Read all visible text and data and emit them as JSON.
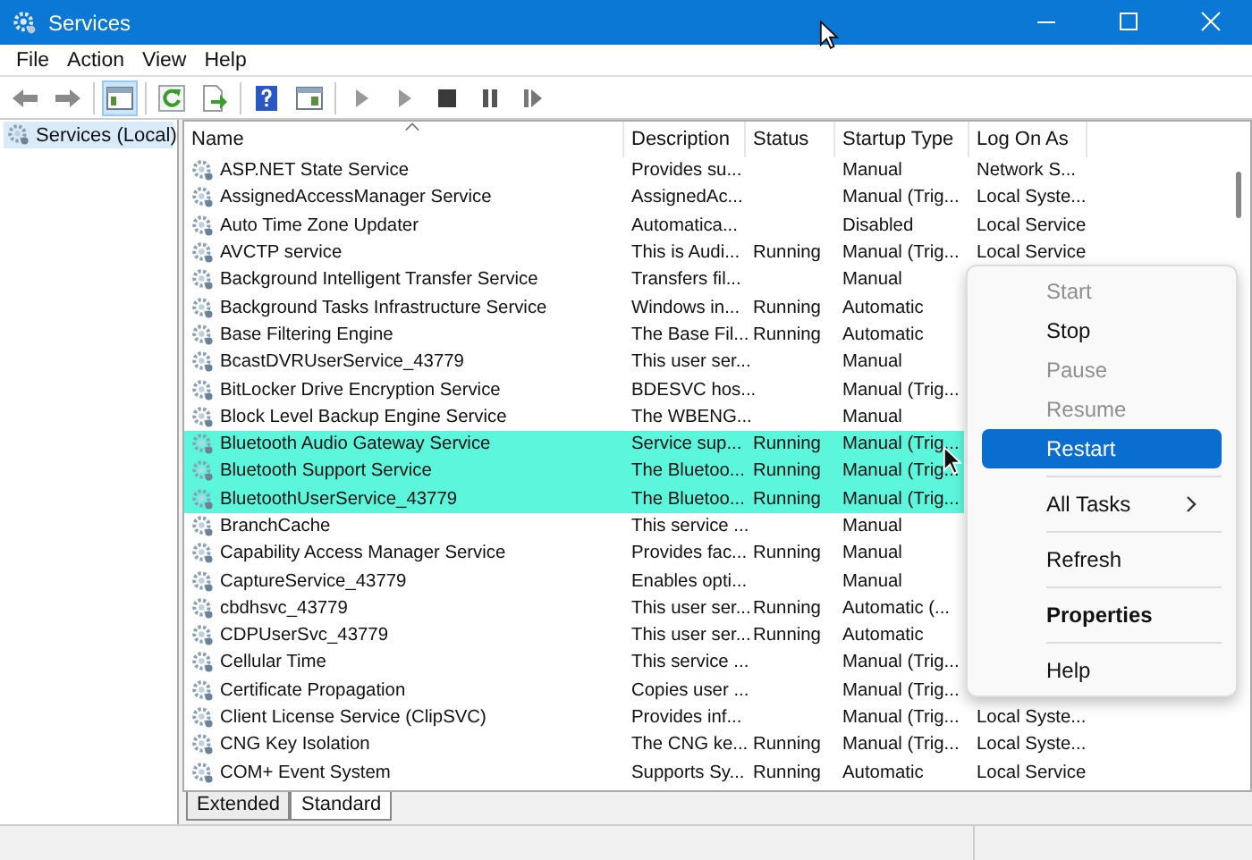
{
  "window": {
    "title": "Services"
  },
  "menu_bar": [
    "File",
    "Action",
    "View",
    "Help"
  ],
  "sidebar": {
    "items": [
      {
        "label": "Services (Local)",
        "selected": true
      }
    ]
  },
  "table": {
    "columns": [
      {
        "label": "Name",
        "sorted": true
      },
      {
        "label": "Description",
        "sorted": false
      },
      {
        "label": "Status",
        "sorted": false
      },
      {
        "label": "Startup Type",
        "sorted": false
      },
      {
        "label": "Log On As",
        "sorted": false
      }
    ],
    "rows": [
      {
        "name": "ASP.NET State Service",
        "description": "Provides su...",
        "status": "",
        "startup_type": "Manual",
        "log_on_as": "Network S...",
        "selected": false
      },
      {
        "name": "AssignedAccessManager Service",
        "description": "AssignedAc...",
        "status": "",
        "startup_type": "Manual (Trig...",
        "log_on_as": "Local Syste...",
        "selected": false
      },
      {
        "name": "Auto Time Zone Updater",
        "description": "Automatica...",
        "status": "",
        "startup_type": "Disabled",
        "log_on_as": "Local Service",
        "selected": false
      },
      {
        "name": "AVCTP service",
        "description": "This is Audi...",
        "status": "Running",
        "startup_type": "Manual (Trig...",
        "log_on_as": "Local Service",
        "selected": false
      },
      {
        "name": "Background Intelligent Transfer Service",
        "description": "Transfers fil...",
        "status": "",
        "startup_type": "Manual",
        "log_on_as": "",
        "selected": false
      },
      {
        "name": "Background Tasks Infrastructure Service",
        "description": "Windows in...",
        "status": "Running",
        "startup_type": "Automatic",
        "log_on_as": "",
        "selected": false
      },
      {
        "name": "Base Filtering Engine",
        "description": "The Base Fil...",
        "status": "Running",
        "startup_type": "Automatic",
        "log_on_as": "",
        "selected": false
      },
      {
        "name": "BcastDVRUserService_43779",
        "description": "This user ser...",
        "status": "",
        "startup_type": "Manual",
        "log_on_as": "",
        "selected": false
      },
      {
        "name": "BitLocker Drive Encryption Service",
        "description": "BDESVC hos...",
        "status": "",
        "startup_type": "Manual (Trig...",
        "log_on_as": "",
        "selected": false
      },
      {
        "name": "Block Level Backup Engine Service",
        "description": "The WBENG...",
        "status": "",
        "startup_type": "Manual",
        "log_on_as": "",
        "selected": false
      },
      {
        "name": "Bluetooth Audio Gateway Service",
        "description": "Service sup...",
        "status": "Running",
        "startup_type": "Manual (Trig...",
        "log_on_as": "",
        "selected": true
      },
      {
        "name": "Bluetooth Support Service",
        "description": "The Bluetoo...",
        "status": "Running",
        "startup_type": "Manual (Trig...",
        "log_on_as": "",
        "selected": true
      },
      {
        "name": "BluetoothUserService_43779",
        "description": "The Bluetoo...",
        "status": "Running",
        "startup_type": "Manual (Trig...",
        "log_on_as": "",
        "selected": true
      },
      {
        "name": "BranchCache",
        "description": "This service ...",
        "status": "",
        "startup_type": "Manual",
        "log_on_as": "",
        "selected": false
      },
      {
        "name": "Capability Access Manager Service",
        "description": "Provides fac...",
        "status": "Running",
        "startup_type": "Manual",
        "log_on_as": "",
        "selected": false
      },
      {
        "name": "CaptureService_43779",
        "description": "Enables opti...",
        "status": "",
        "startup_type": "Manual",
        "log_on_as": "",
        "selected": false
      },
      {
        "name": "cbdhsvc_43779",
        "description": "This user ser...",
        "status": "Running",
        "startup_type": "Automatic (...",
        "log_on_as": "",
        "selected": false
      },
      {
        "name": "CDPUserSvc_43779",
        "description": "This user ser...",
        "status": "Running",
        "startup_type": "Automatic",
        "log_on_as": "",
        "selected": false
      },
      {
        "name": "Cellular Time",
        "description": "This service ...",
        "status": "",
        "startup_type": "Manual (Trig...",
        "log_on_as": "",
        "selected": false
      },
      {
        "name": "Certificate Propagation",
        "description": "Copies user ...",
        "status": "",
        "startup_type": "Manual (Trig...",
        "log_on_as": "",
        "selected": false
      },
      {
        "name": "Client License Service (ClipSVC)",
        "description": "Provides inf...",
        "status": "",
        "startup_type": "Manual (Trig...",
        "log_on_as": "Local Syste...",
        "selected": false
      },
      {
        "name": "CNG Key Isolation",
        "description": "The CNG ke...",
        "status": "Running",
        "startup_type": "Manual (Trig...",
        "log_on_as": "Local Syste...",
        "selected": false
      },
      {
        "name": "COM+ Event System",
        "description": "Supports Sy...",
        "status": "Running",
        "startup_type": "Automatic",
        "log_on_as": "Local Service",
        "selected": false
      }
    ]
  },
  "context_menu": [
    {
      "kind": "item",
      "label": "Start",
      "disabled": true,
      "highlighted": false,
      "bold": false,
      "submenu": false
    },
    {
      "kind": "item",
      "label": "Stop",
      "disabled": false,
      "highlighted": false,
      "bold": false,
      "submenu": false
    },
    {
      "kind": "item",
      "label": "Pause",
      "disabled": true,
      "highlighted": false,
      "bold": false,
      "submenu": false
    },
    {
      "kind": "item",
      "label": "Resume",
      "disabled": true,
      "highlighted": false,
      "bold": false,
      "submenu": false
    },
    {
      "kind": "item",
      "label": "Restart",
      "disabled": false,
      "highlighted": true,
      "bold": false,
      "submenu": false
    },
    {
      "kind": "separator"
    },
    {
      "kind": "item",
      "label": "All Tasks",
      "disabled": false,
      "highlighted": false,
      "bold": false,
      "submenu": true
    },
    {
      "kind": "separator"
    },
    {
      "kind": "item",
      "label": "Refresh",
      "disabled": false,
      "highlighted": false,
      "bold": false,
      "submenu": false
    },
    {
      "kind": "separator"
    },
    {
      "kind": "item",
      "label": "Properties",
      "disabled": false,
      "highlighted": false,
      "bold": true,
      "submenu": false
    },
    {
      "kind": "separator"
    },
    {
      "kind": "item",
      "label": "Help",
      "disabled": false,
      "highlighted": false,
      "bold": false,
      "submenu": false
    }
  ],
  "view_tabs": [
    {
      "label": "Extended",
      "selected": false
    },
    {
      "label": "Standard",
      "selected": true
    }
  ]
}
